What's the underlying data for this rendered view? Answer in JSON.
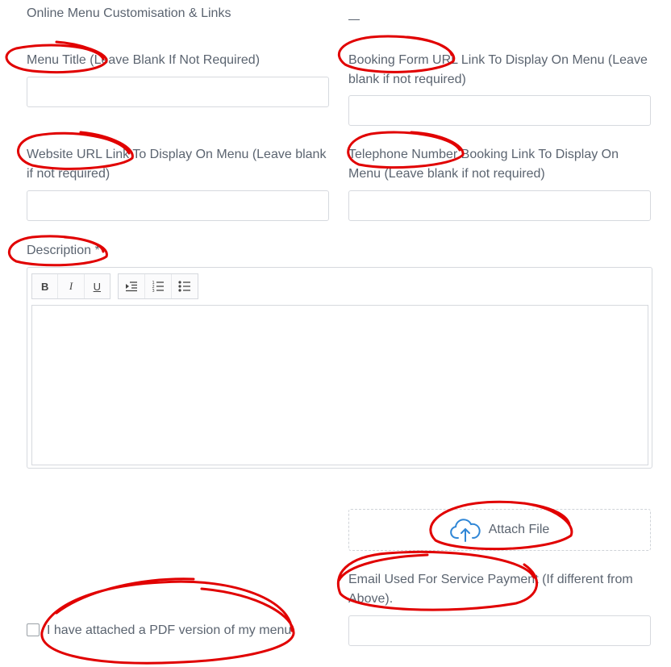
{
  "section": {
    "title": "Online Menu Customisation & Links"
  },
  "fields": {
    "menu_title_label": "Menu Title (Leave Blank If Not Required)",
    "booking_form_label": "Booking Form URL Link To Display On Menu (Leave blank if not required)",
    "website_url_label": "Website URL Link To Display On Menu (Leave blank if not required)",
    "telephone_label": "Telephone Number Booking Link To Display On Menu (Leave blank if not required)",
    "description_label": "Description *",
    "email_label": "Email Used For Service Payment (If different from Above)."
  },
  "editor": {
    "toolbar": {
      "bold": "B",
      "italic": "I",
      "underline": "U"
    }
  },
  "attach": {
    "label": "Attach File",
    "icon": "cloud-upload-icon",
    "icon_color": "#2f86d6"
  },
  "pdf_checkbox": {
    "label": "I have attached a PDF version of my menu.",
    "checked": false
  },
  "annotation_color": "#e10000"
}
